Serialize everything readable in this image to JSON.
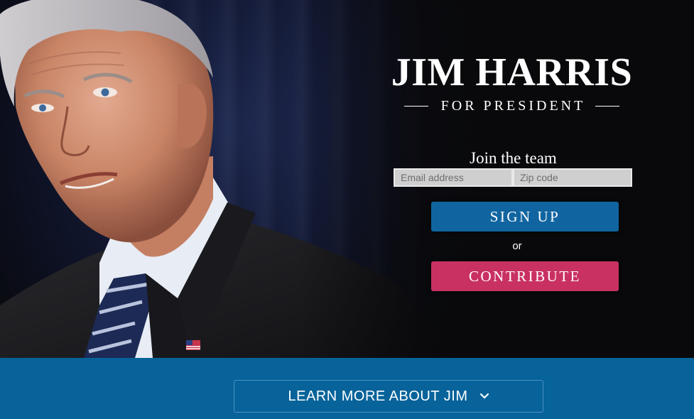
{
  "hero": {
    "title": "JIM HARRIS",
    "subtitle": "FOR PRESIDENT",
    "photo_icon": "candidate-portrait"
  },
  "signup": {
    "heading": "Join the team",
    "email_placeholder": "Email address",
    "zip_placeholder": "Zip code",
    "signup_label": "SIGN UP",
    "or_label": "or",
    "contribute_label": "CONTRIBUTE"
  },
  "footer": {
    "learn_more_label": "LEARN MORE ABOUT JIM",
    "chevron_icon": "chevron-down-icon"
  },
  "colors": {
    "signup_blue": "#1065a0",
    "contribute_pink": "#c93163",
    "footer_blue": "#07639a"
  }
}
